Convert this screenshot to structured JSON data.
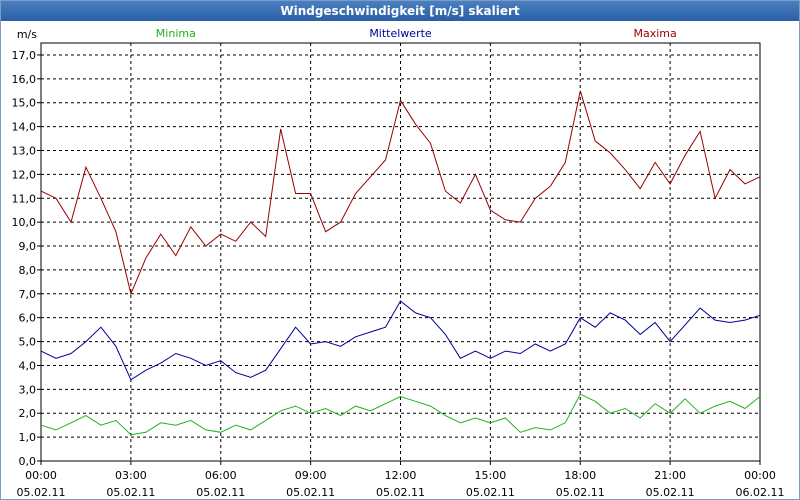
{
  "window": {
    "title": "Windgeschwindigkeit [m/s] skaliert"
  },
  "colors": {
    "min": "#1fb41f",
    "mean": "#000099",
    "max": "#990000",
    "grid": "#000000",
    "titlebar": "#2f64a8"
  },
  "chart_data": {
    "type": "line",
    "title": "Windgeschwindigkeit [m/s] skaliert",
    "ylabel": "m/s",
    "xlabel": "",
    "ylim": [
      0,
      17.5
    ],
    "yticks": [
      "0,0",
      "1,0",
      "2,0",
      "3,0",
      "4,0",
      "5,0",
      "6,0",
      "7,0",
      "8,0",
      "9,0",
      "10,0",
      "11,0",
      "12,0",
      "13,0",
      "14,0",
      "15,0",
      "16,0",
      "17,0"
    ],
    "xlim": [
      0,
      24
    ],
    "xticks": [
      {
        "time": "00:00",
        "date": "05.02.11"
      },
      {
        "time": "03:00",
        "date": "05.02.11"
      },
      {
        "time": "06:00",
        "date": "05.02.11"
      },
      {
        "time": "09:00",
        "date": "05.02.11"
      },
      {
        "time": "12:00",
        "date": "05.02.11"
      },
      {
        "time": "15:00",
        "date": "05.02.11"
      },
      {
        "time": "18:00",
        "date": "05.02.11"
      },
      {
        "time": "21:00",
        "date": "05.02.11"
      },
      {
        "time": "00:00",
        "date": "06.02.11"
      }
    ],
    "grid": true,
    "legend_position": "top",
    "x_hours": [
      0,
      0.5,
      1,
      1.5,
      2,
      2.5,
      3,
      3.5,
      4,
      4.5,
      5,
      5.5,
      6,
      6.5,
      7,
      7.5,
      8,
      8.5,
      9,
      9.5,
      10,
      10.5,
      11,
      11.5,
      12,
      12.5,
      13,
      13.5,
      14,
      14.5,
      15,
      15.5,
      16,
      16.5,
      17,
      17.5,
      18,
      18.5,
      19,
      19.5,
      20,
      20.5,
      21,
      21.5,
      22,
      22.5,
      23,
      23.5,
      24
    ],
    "series": [
      {
        "name": "Minima",
        "color": "#1fb41f",
        "values": [
          1.5,
          1.3,
          1.6,
          1.9,
          1.5,
          1.7,
          1.1,
          1.2,
          1.6,
          1.5,
          1.7,
          1.3,
          1.2,
          1.5,
          1.3,
          1.7,
          2.1,
          2.3,
          2.0,
          2.2,
          1.9,
          2.3,
          2.1,
          2.4,
          2.7,
          2.5,
          2.3,
          1.9,
          1.6,
          1.8,
          1.6,
          1.8,
          1.2,
          1.4,
          1.3,
          1.6,
          2.8,
          2.5,
          2.0,
          2.2,
          1.8,
          2.4,
          2.0,
          2.6,
          2.0,
          2.3,
          2.5,
          2.2,
          2.7
        ]
      },
      {
        "name": "Mittelwerte",
        "color": "#000099",
        "values": [
          4.6,
          4.3,
          4.5,
          5.0,
          5.6,
          4.8,
          3.4,
          3.8,
          4.1,
          4.5,
          4.3,
          4.0,
          4.2,
          3.7,
          3.5,
          3.8,
          4.7,
          5.6,
          4.9,
          5.0,
          4.8,
          5.2,
          5.4,
          5.6,
          6.7,
          6.2,
          6.0,
          5.3,
          4.3,
          4.6,
          4.3,
          4.6,
          4.5,
          4.9,
          4.6,
          4.9,
          6.0,
          5.6,
          6.2,
          5.9,
          5.3,
          5.8,
          5.0,
          5.7,
          6.4,
          5.9,
          5.8,
          5.9,
          6.1
        ]
      },
      {
        "name": "Maxima",
        "color": "#990000",
        "values": [
          11.3,
          11.0,
          10.0,
          12.3,
          11.0,
          9.6,
          7.0,
          8.5,
          9.5,
          8.6,
          9.8,
          9.0,
          9.5,
          9.2,
          10.0,
          9.4,
          13.9,
          11.2,
          11.2,
          9.6,
          10.0,
          11.2,
          11.9,
          12.6,
          15.1,
          14.1,
          13.3,
          11.3,
          10.8,
          12.0,
          10.5,
          10.1,
          10.0,
          11.0,
          11.5,
          12.5,
          15.5,
          13.4,
          12.9,
          12.2,
          11.4,
          12.5,
          11.6,
          12.8,
          13.8,
          11.0,
          12.2,
          11.6,
          11.9
        ]
      }
    ]
  }
}
